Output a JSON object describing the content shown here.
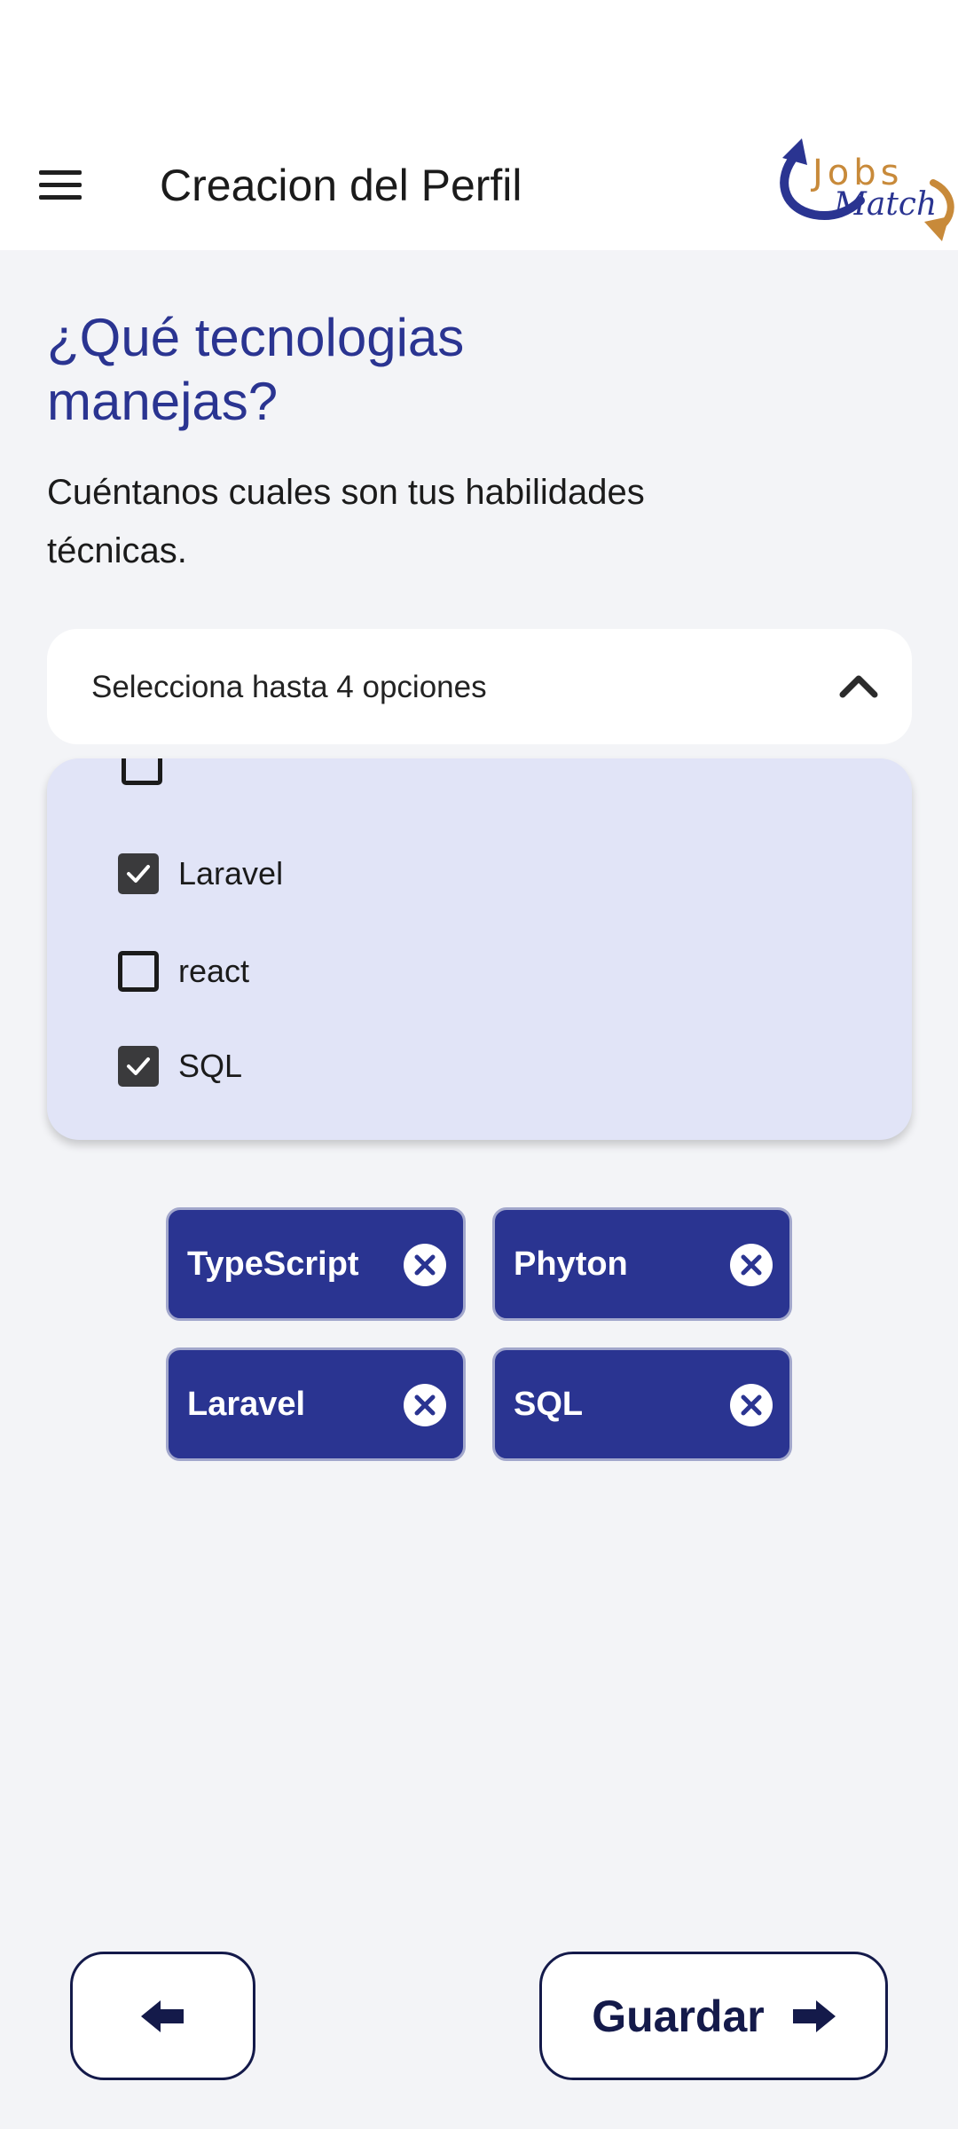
{
  "app_bar": {
    "title": "Creacion del Perfil",
    "menu_icon": "hamburger-menu-icon",
    "logo": {
      "line1": "Jobs",
      "line2": "Match",
      "colors": {
        "primary": "#2a3491",
        "accent": "#c88a3a"
      }
    }
  },
  "main": {
    "question": "¿Qué tecnologias manejas?",
    "subtitle": "Cuéntanos cuales son tus habilidades técnicas."
  },
  "select": {
    "placeholder": "Selecciona hasta 4 opciones",
    "icon": "chevron-up-icon",
    "options": [
      {
        "label": "Laravel",
        "checked": true
      },
      {
        "label": "react",
        "checked": false
      },
      {
        "label": "SQL",
        "checked": true
      }
    ]
  },
  "selected_chips": [
    {
      "label": "TypeScript",
      "icon": "close-circle-icon"
    },
    {
      "label": "Phyton",
      "icon": "close-circle-icon"
    },
    {
      "label": "Laravel",
      "icon": "close-circle-icon"
    },
    {
      "label": "SQL",
      "icon": "close-circle-icon"
    }
  ],
  "footer": {
    "back_icon": "arrow-left-icon",
    "save_label": "Guardar",
    "save_icon": "arrow-right-icon"
  },
  "colors": {
    "primary": "#2a3491",
    "dropdown_bg": "#e1e4f7",
    "page_bg": "#f3f4f7",
    "button_border": "#141a4a"
  }
}
